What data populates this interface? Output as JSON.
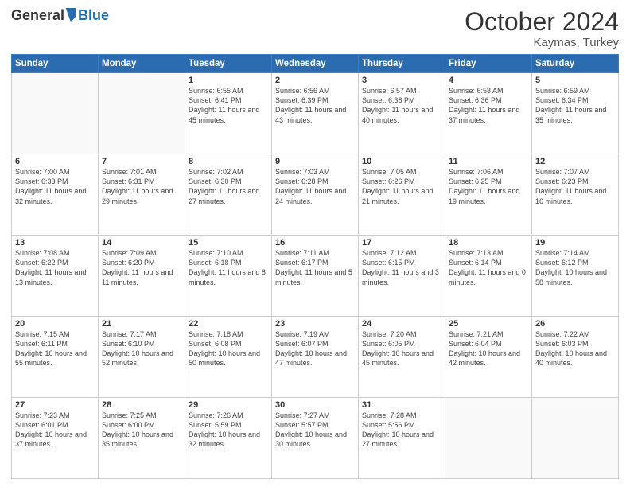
{
  "logo": {
    "general": "General",
    "blue": "Blue"
  },
  "title": {
    "month": "October 2024",
    "location": "Kaymas, Turkey"
  },
  "weekdays": [
    "Sunday",
    "Monday",
    "Tuesday",
    "Wednesday",
    "Thursday",
    "Friday",
    "Saturday"
  ],
  "weeks": [
    [
      {
        "day": null
      },
      {
        "day": null
      },
      {
        "day": 1,
        "sunrise": "6:55 AM",
        "sunset": "6:41 PM",
        "daylight": "11 hours and 45 minutes."
      },
      {
        "day": 2,
        "sunrise": "6:56 AM",
        "sunset": "6:39 PM",
        "daylight": "11 hours and 43 minutes."
      },
      {
        "day": 3,
        "sunrise": "6:57 AM",
        "sunset": "6:38 PM",
        "daylight": "11 hours and 40 minutes."
      },
      {
        "day": 4,
        "sunrise": "6:58 AM",
        "sunset": "6:36 PM",
        "daylight": "11 hours and 37 minutes."
      },
      {
        "day": 5,
        "sunrise": "6:59 AM",
        "sunset": "6:34 PM",
        "daylight": "11 hours and 35 minutes."
      }
    ],
    [
      {
        "day": 6,
        "sunrise": "7:00 AM",
        "sunset": "6:33 PM",
        "daylight": "11 hours and 32 minutes."
      },
      {
        "day": 7,
        "sunrise": "7:01 AM",
        "sunset": "6:31 PM",
        "daylight": "11 hours and 29 minutes."
      },
      {
        "day": 8,
        "sunrise": "7:02 AM",
        "sunset": "6:30 PM",
        "daylight": "11 hours and 27 minutes."
      },
      {
        "day": 9,
        "sunrise": "7:03 AM",
        "sunset": "6:28 PM",
        "daylight": "11 hours and 24 minutes."
      },
      {
        "day": 10,
        "sunrise": "7:05 AM",
        "sunset": "6:26 PM",
        "daylight": "11 hours and 21 minutes."
      },
      {
        "day": 11,
        "sunrise": "7:06 AM",
        "sunset": "6:25 PM",
        "daylight": "11 hours and 19 minutes."
      },
      {
        "day": 12,
        "sunrise": "7:07 AM",
        "sunset": "6:23 PM",
        "daylight": "11 hours and 16 minutes."
      }
    ],
    [
      {
        "day": 13,
        "sunrise": "7:08 AM",
        "sunset": "6:22 PM",
        "daylight": "11 hours and 13 minutes."
      },
      {
        "day": 14,
        "sunrise": "7:09 AM",
        "sunset": "6:20 PM",
        "daylight": "11 hours and 11 minutes."
      },
      {
        "day": 15,
        "sunrise": "7:10 AM",
        "sunset": "6:18 PM",
        "daylight": "11 hours and 8 minutes."
      },
      {
        "day": 16,
        "sunrise": "7:11 AM",
        "sunset": "6:17 PM",
        "daylight": "11 hours and 5 minutes."
      },
      {
        "day": 17,
        "sunrise": "7:12 AM",
        "sunset": "6:15 PM",
        "daylight": "11 hours and 3 minutes."
      },
      {
        "day": 18,
        "sunrise": "7:13 AM",
        "sunset": "6:14 PM",
        "daylight": "11 hours and 0 minutes."
      },
      {
        "day": 19,
        "sunrise": "7:14 AM",
        "sunset": "6:12 PM",
        "daylight": "10 hours and 58 minutes."
      }
    ],
    [
      {
        "day": 20,
        "sunrise": "7:15 AM",
        "sunset": "6:11 PM",
        "daylight": "10 hours and 55 minutes."
      },
      {
        "day": 21,
        "sunrise": "7:17 AM",
        "sunset": "6:10 PM",
        "daylight": "10 hours and 52 minutes."
      },
      {
        "day": 22,
        "sunrise": "7:18 AM",
        "sunset": "6:08 PM",
        "daylight": "10 hours and 50 minutes."
      },
      {
        "day": 23,
        "sunrise": "7:19 AM",
        "sunset": "6:07 PM",
        "daylight": "10 hours and 47 minutes."
      },
      {
        "day": 24,
        "sunrise": "7:20 AM",
        "sunset": "6:05 PM",
        "daylight": "10 hours and 45 minutes."
      },
      {
        "day": 25,
        "sunrise": "7:21 AM",
        "sunset": "6:04 PM",
        "daylight": "10 hours and 42 minutes."
      },
      {
        "day": 26,
        "sunrise": "7:22 AM",
        "sunset": "6:03 PM",
        "daylight": "10 hours and 40 minutes."
      }
    ],
    [
      {
        "day": 27,
        "sunrise": "7:23 AM",
        "sunset": "6:01 PM",
        "daylight": "10 hours and 37 minutes."
      },
      {
        "day": 28,
        "sunrise": "7:25 AM",
        "sunset": "6:00 PM",
        "daylight": "10 hours and 35 minutes."
      },
      {
        "day": 29,
        "sunrise": "7:26 AM",
        "sunset": "5:59 PM",
        "daylight": "10 hours and 32 minutes."
      },
      {
        "day": 30,
        "sunrise": "7:27 AM",
        "sunset": "5:57 PM",
        "daylight": "10 hours and 30 minutes."
      },
      {
        "day": 31,
        "sunrise": "7:28 AM",
        "sunset": "5:56 PM",
        "daylight": "10 hours and 27 minutes."
      },
      {
        "day": null
      },
      {
        "day": null
      }
    ]
  ],
  "labels": {
    "sunrise": "Sunrise:",
    "sunset": "Sunset:",
    "daylight": "Daylight:"
  }
}
